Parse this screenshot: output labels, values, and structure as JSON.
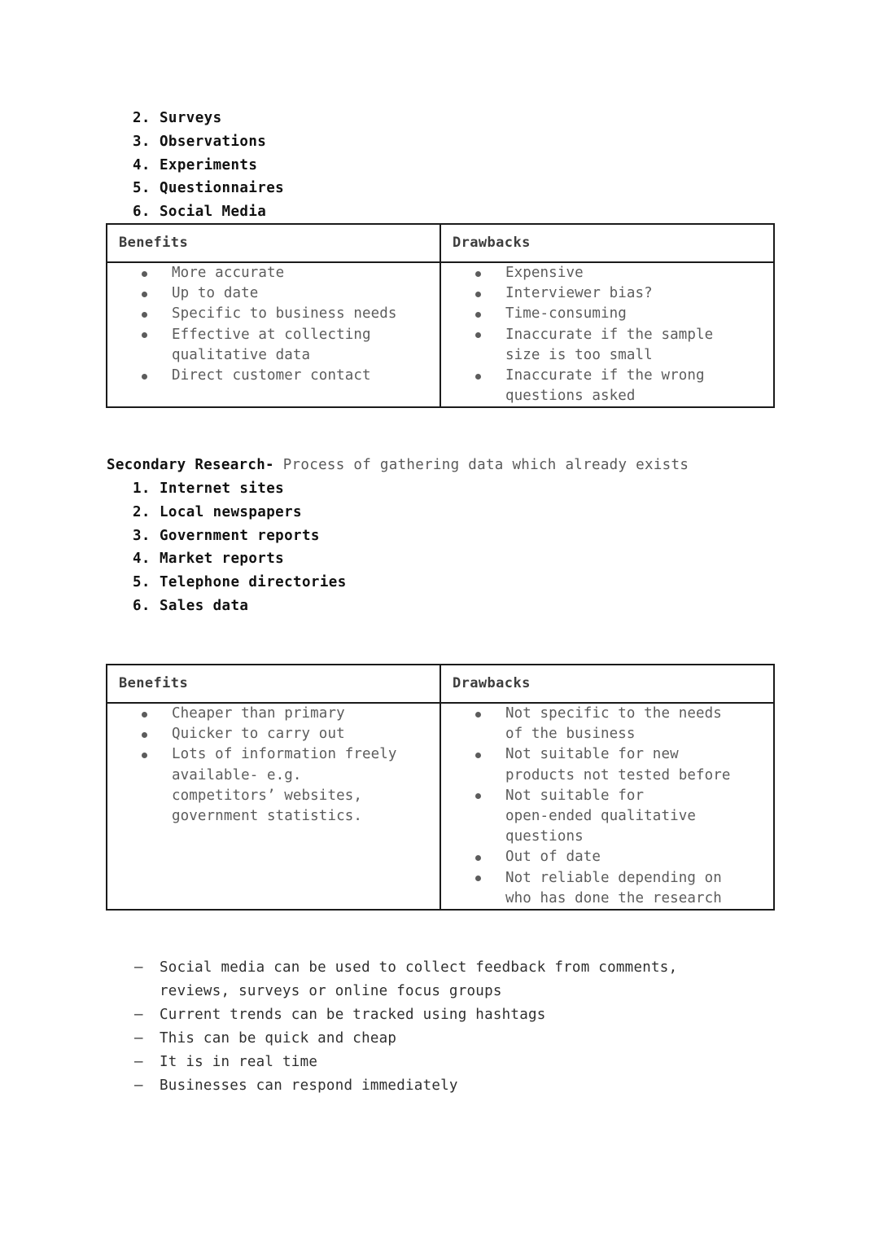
{
  "document": {
    "primary_research": {
      "methods_list_start_number": 2,
      "methods": [
        "Surveys",
        "Observations",
        "Experiments",
        "Questionnaires",
        "Social Media"
      ],
      "table": {
        "headers": {
          "benefits": "Benefits",
          "drawbacks": "Drawbacks"
        },
        "benefits": [
          "More accurate",
          "Up to date",
          "Specific to business needs",
          "Effective at collecting\nqualitative data",
          "Direct customer contact"
        ],
        "drawbacks": [
          "Expensive",
          "Interviewer bias?",
          "Time-consuming",
          "Inaccurate if the sample\nsize is too small",
          "Inaccurate if the wrong\nquestions asked"
        ]
      }
    },
    "secondary_research": {
      "heading_bold": "Secondary Research-",
      "heading_rest": " Process of gathering data which already exists",
      "sources_list_start_number": 1,
      "sources": [
        "Internet sites",
        "Local newspapers",
        "Government reports",
        "Market reports",
        "Telephone directories",
        "Sales data"
      ],
      "table": {
        "headers": {
          "benefits": "Benefits",
          "drawbacks": "Drawbacks"
        },
        "benefits": [
          "Cheaper than primary",
          "Quicker to carry out",
          "Lots of information freely\navailable- e.g.\ncompetitors’ websites,\ngovernment statistics."
        ],
        "drawbacks": [
          "Not specific to the needs\nof the business",
          "Not suitable for new\nproducts not tested before",
          "Not suitable for\nopen-ended qualitative\nquestions",
          "Out of date",
          "Not reliable depending on\nwho has done the research"
        ]
      }
    },
    "social_media_notes": [
      "Social media can be used to collect feedback from comments,\nreviews, surveys or online focus groups",
      "Current trends can be tracked using hashtags",
      "This can be quick and cheap",
      "It is in real time",
      "Businesses can respond immediately"
    ]
  },
  "colors": {
    "page_background": "#ffffff",
    "heading_text": "#111111",
    "table_border": "#1b1b1b",
    "table_header_text": "#3d3d3d",
    "table_body_text": "#5c5c5c",
    "note_text": "#2f2f2f"
  }
}
